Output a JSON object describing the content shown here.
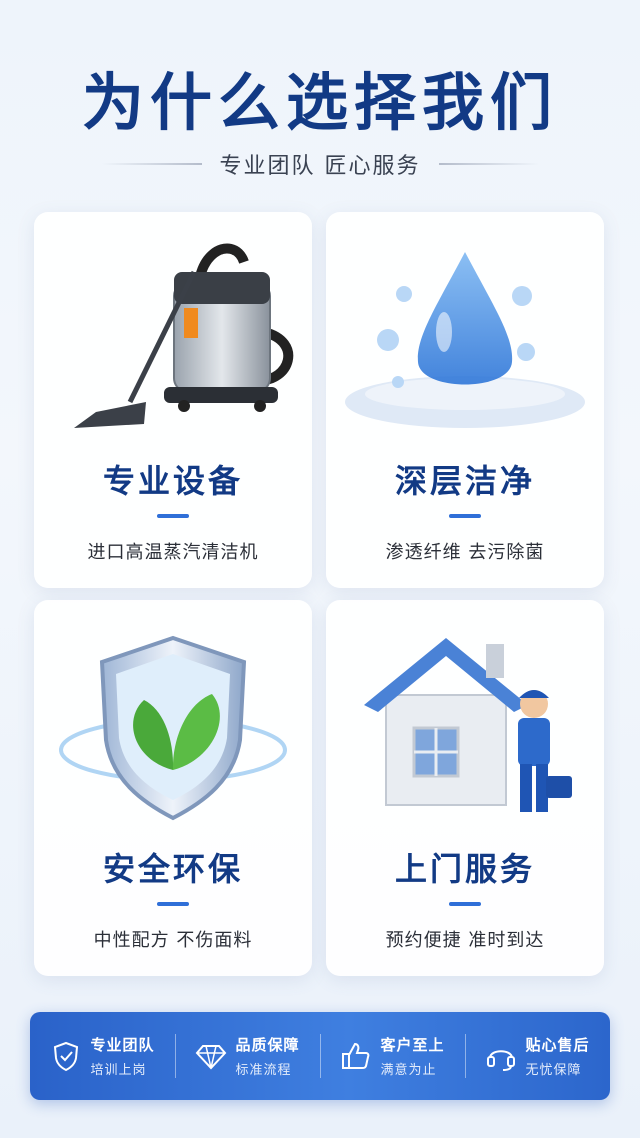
{
  "header": {
    "title": "为什么选择我们",
    "subtitle": "专业团队  匠心服务"
  },
  "cards": [
    {
      "title": "专业设备",
      "desc": "进口高温蒸汽清洁机",
      "icon": "vacuum-cleaner-icon"
    },
    {
      "title": "深层洁净",
      "desc": "渗透纤维  去污除菌",
      "icon": "water-drop-icon"
    },
    {
      "title": "安全环保",
      "desc": "中性配方  不伤面料",
      "icon": "leaf-shield-icon"
    },
    {
      "title": "上门服务",
      "desc": "预约便捷  准时到达",
      "icon": "house-worker-icon"
    }
  ],
  "features": [
    {
      "title": "专业团队",
      "sub": "培训上岗",
      "icon": "shield-check-icon"
    },
    {
      "title": "品质保障",
      "sub": "标准流程",
      "icon": "diamond-icon"
    },
    {
      "title": "客户至上",
      "sub": "满意为止",
      "icon": "thumbs-up-icon"
    },
    {
      "title": "贴心售后",
      "sub": "无忧保障",
      "icon": "headset-icon"
    }
  ],
  "colors": {
    "title": "#123a85",
    "accent": "#2f6fd8",
    "banner": "#3f7fe0"
  }
}
